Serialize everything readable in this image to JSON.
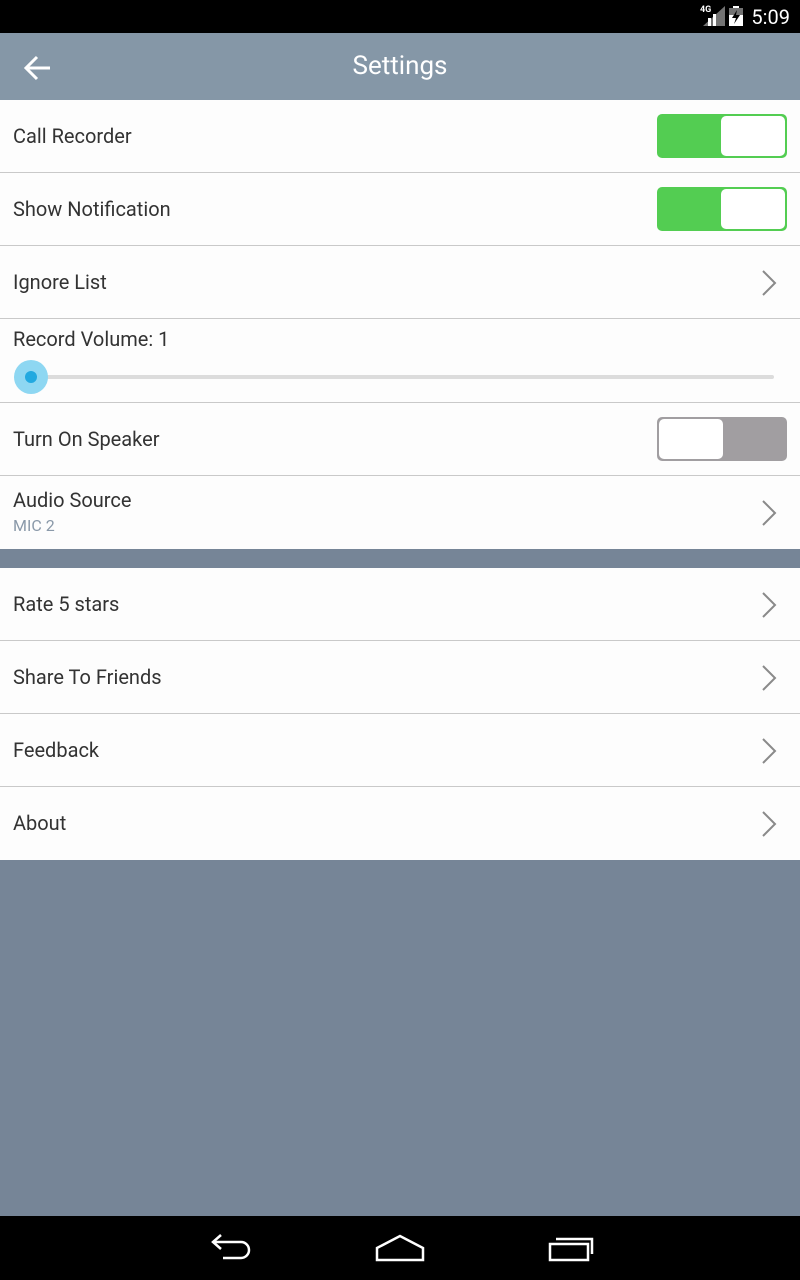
{
  "status": {
    "network": "4G",
    "time": "5:09"
  },
  "header": {
    "title": "Settings",
    "back_icon": "arrow-left-icon"
  },
  "settings": {
    "call_recorder": {
      "label": "Call Recorder",
      "enabled": true
    },
    "show_notification": {
      "label": "Show Notification",
      "enabled": true
    },
    "ignore_list": {
      "label": "Ignore List"
    },
    "record_volume": {
      "label": "Record Volume: 1",
      "value": 1,
      "min": 1,
      "max": 10
    },
    "turn_on_speaker": {
      "label": "Turn On Speaker",
      "enabled": false
    },
    "audio_source": {
      "label": "Audio Source",
      "value": "MIC 2"
    }
  },
  "extras": {
    "rate": {
      "label": "Rate 5 stars"
    },
    "share": {
      "label": "Share To Friends"
    },
    "feedback": {
      "label": "Feedback"
    },
    "about": {
      "label": "About"
    }
  },
  "colors": {
    "accent_green": "#53cd52",
    "app_bar": "#8597a7",
    "background": "#768597",
    "slider_thumb": "#22a9e0"
  }
}
